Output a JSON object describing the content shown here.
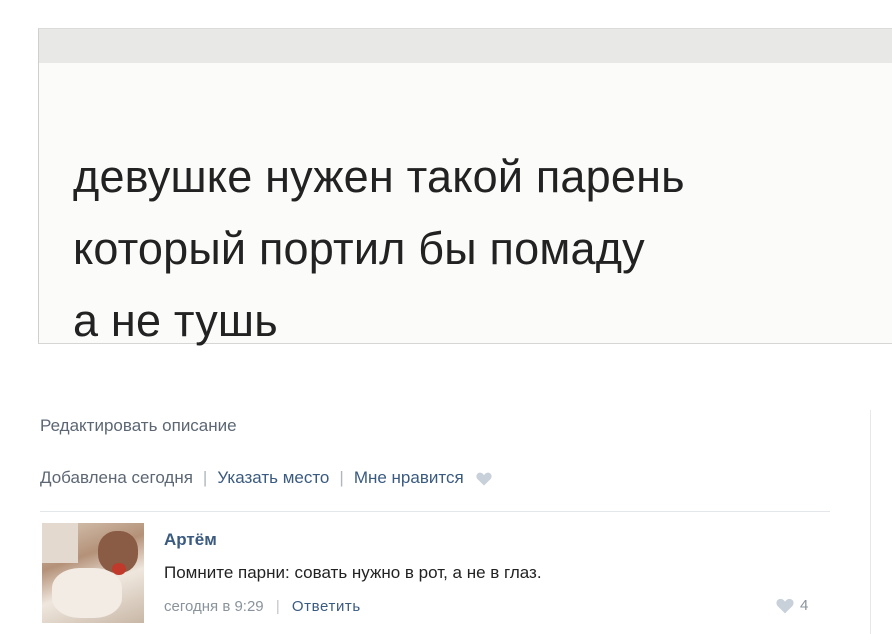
{
  "photo": {
    "caption_lines": [
      "девушке нужен такой парень",
      "который портил бы помаду",
      "а не тушь"
    ]
  },
  "actions": {
    "edit_description": "Редактировать описание",
    "added": "Добавлена сегодня",
    "set_location": "Указать место",
    "like": "Мне нравится",
    "separator": "|"
  },
  "comment": {
    "author": "Артём",
    "text": "Помните парни: совать нужно в рот, а не в глаз.",
    "time": "сегодня в 9:29",
    "reply": "Ответить",
    "likes": "4"
  },
  "colors": {
    "link": "#3a5a80",
    "muted": "#8a939c",
    "heart": "#c8d0da"
  },
  "icons": {
    "like": "heart-icon",
    "comment_like": "heart-icon"
  }
}
